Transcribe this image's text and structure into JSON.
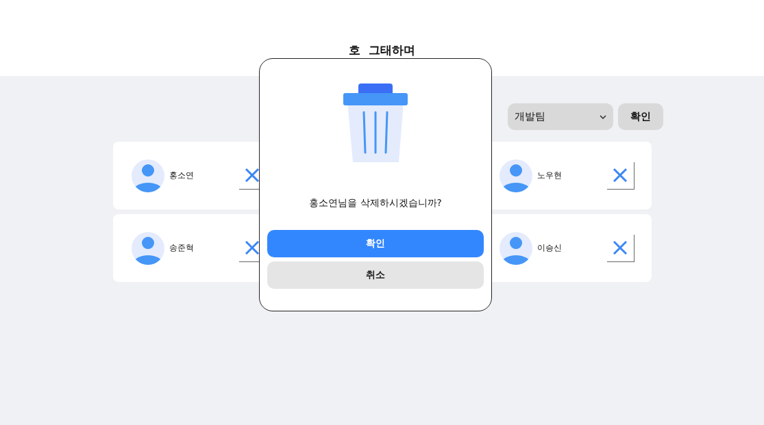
{
  "header": {
    "title": "호  그태하며"
  },
  "filter": {
    "team": "개발팀",
    "button": "확인"
  },
  "members": [
    {
      "name": "홍소연"
    },
    {
      "name": "노우현"
    },
    {
      "name": "송준혁"
    },
    {
      "name": "이승신"
    }
  ],
  "dialog": {
    "message": "홍소연님을 삭제하시겠습니까?",
    "confirm": "확인",
    "cancel": "취소"
  }
}
